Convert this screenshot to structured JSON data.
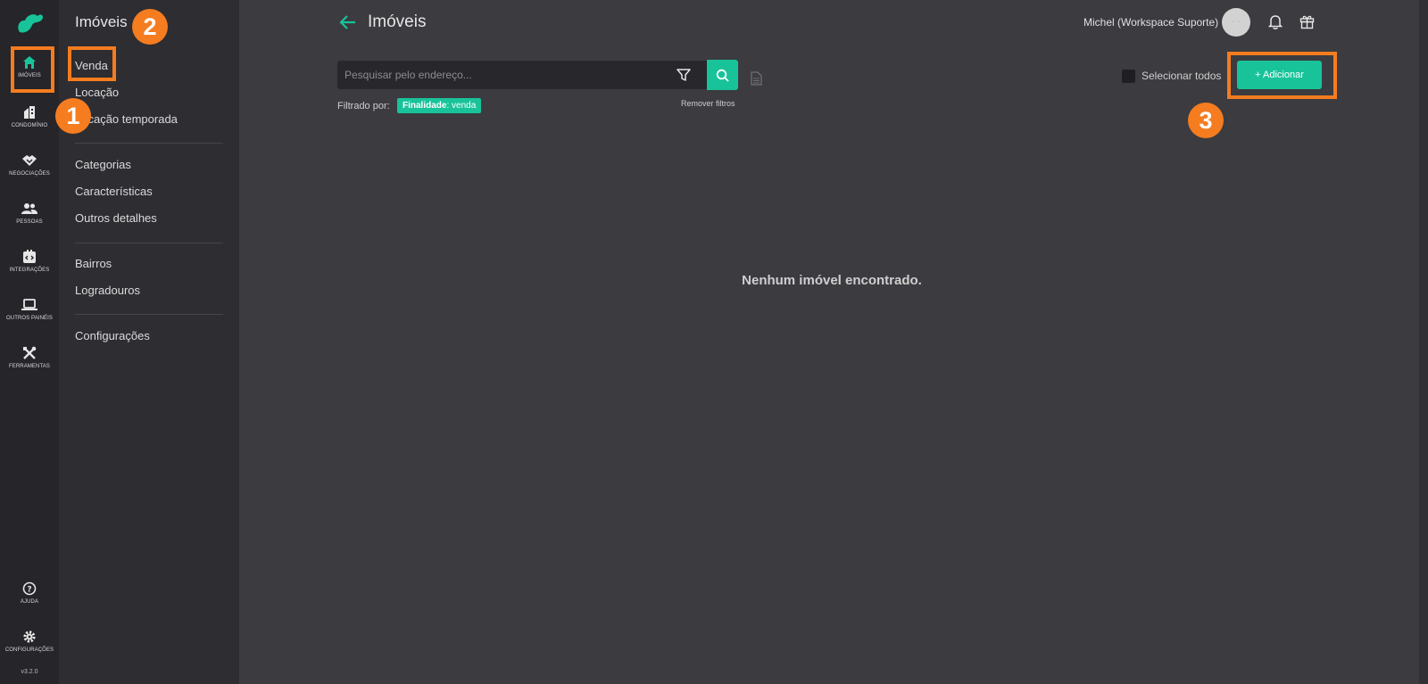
{
  "rail": {
    "items": [
      {
        "label": "IMÓVEIS",
        "icon": "home-icon"
      },
      {
        "label": "CONDOMÍNIO",
        "icon": "building-icon"
      },
      {
        "label": "NEGOCIAÇÕES",
        "icon": "handshake-icon"
      },
      {
        "label": "PESSOAS",
        "icon": "people-icon"
      },
      {
        "label": "INTEGRAÇÕES",
        "icon": "integration-icon"
      },
      {
        "label": "OUTROS PAINÉIS",
        "icon": "laptop-icon"
      },
      {
        "label": "FERRAMENTAS",
        "icon": "tools-icon"
      }
    ],
    "help_label": "AJUDA",
    "settings_label": "CONFIGURAÇÕES",
    "version": "v3.2.0"
  },
  "menu": {
    "title": "Imóveis",
    "items": [
      "Venda",
      "Locação",
      "Locação temporada",
      "Categorias",
      "Características",
      "Outros detalhes",
      "Bairros",
      "Logradouros",
      "Configurações"
    ]
  },
  "header": {
    "title": "Imóveis",
    "user_name": "Michel (Workspace Suporte)",
    "avatar_initials": "- -"
  },
  "search": {
    "placeholder": "Pesquisar pelo endereço...",
    "filtered_label": "Filtrado por:",
    "chip_key": "Finalidade",
    "chip_value": ": venda",
    "remove_filters": "Remover filtros"
  },
  "toolbar": {
    "select_all": "Selecionar todos",
    "add_label": "+ Adicionar"
  },
  "main": {
    "empty_message": "Nenhum imóvel encontrado."
  },
  "annotations": [
    "1",
    "2",
    "3"
  ],
  "colors": {
    "accent": "#19c39a",
    "highlight": "#f57c1f",
    "rail_bg": "#25252a",
    "menu_bg": "#2d2d32",
    "main_bg": "#3b3b40"
  }
}
